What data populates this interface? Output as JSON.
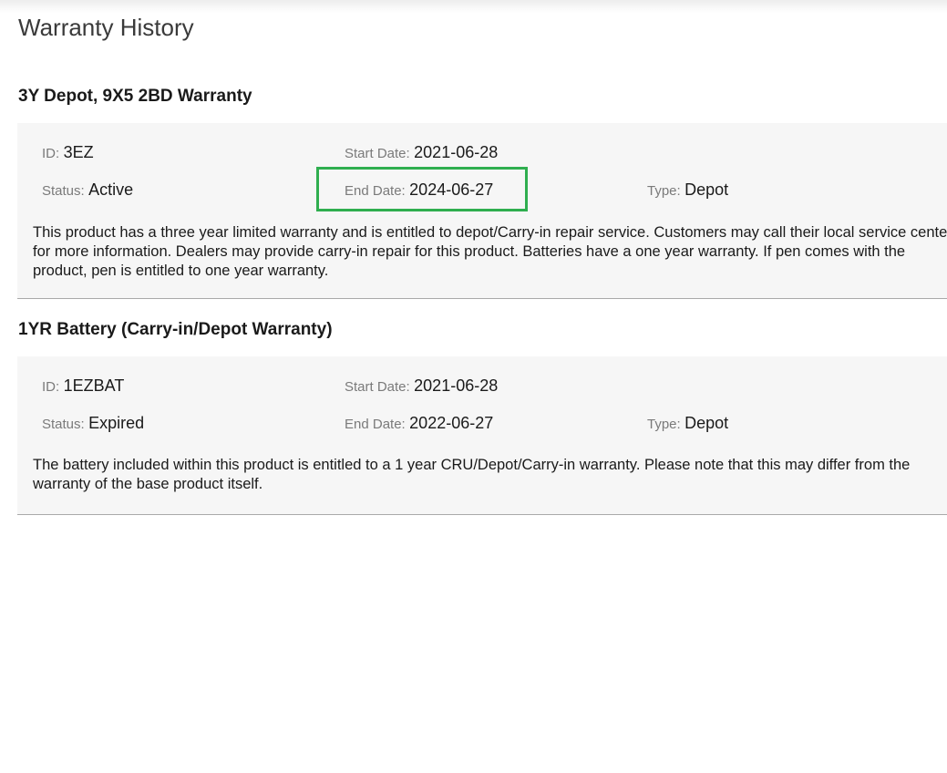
{
  "page": {
    "title": "Warranty History"
  },
  "warranties": [
    {
      "title": "3Y Depot, 9X5 2BD Warranty",
      "id_label": "ID:",
      "id_value": "3EZ",
      "status_label": "Status:",
      "status_value": "Active",
      "start_label": "Start Date:",
      "start_value": "2021-06-28",
      "end_label": "End Date:",
      "end_value": "2024-06-27",
      "type_label": "Type:",
      "type_value": "Depot",
      "description": "This product has a three year limited warranty and is entitled to depot/Carry-in repair service. Customers may call their local service center for more information. Dealers may provide carry-in repair for this product. Batteries have a one year warranty. If pen comes with the product, pen is entitled to one year warranty.",
      "end_date_highlighted": true
    },
    {
      "title": "1YR Battery (Carry-in/Depot Warranty)",
      "id_label": "ID:",
      "id_value": "1EZBAT",
      "status_label": "Status:",
      "status_value": "Expired",
      "start_label": "Start Date:",
      "start_value": "2021-06-28",
      "end_label": "End Date:",
      "end_value": "2022-06-27",
      "type_label": "Type:",
      "type_value": "Depot",
      "description": "The battery included within this product is entitled to a 1 year CRU/Depot/Carry-in warranty. Please note that this may differ from the warranty of the base product itself.",
      "end_date_highlighted": false
    }
  ],
  "colors": {
    "highlight": "#2fae4f",
    "panel_background": "#f6f6f6",
    "label_text": "#7a7a7a"
  }
}
